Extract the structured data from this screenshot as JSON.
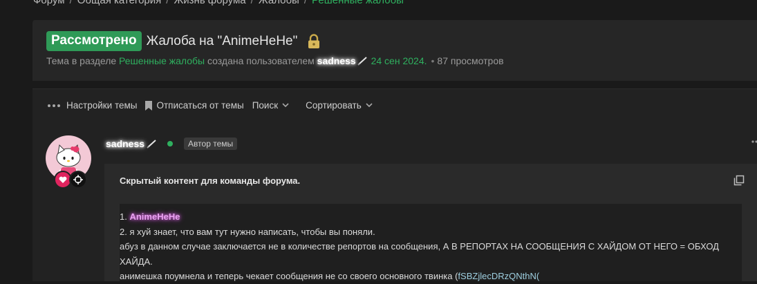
{
  "breadcrumb": {
    "items": [
      "Форум",
      "Общая категория",
      "Жизнь форума",
      "Жалобы"
    ],
    "current": "Решенные жалобы",
    "separator": "/"
  },
  "thread": {
    "status_badge": "Рассмотрено",
    "title": "Жалоба на \"AnimeHeHe\"",
    "locked_icon": "lock-icon",
    "meta_prefix": "Тема в разделе",
    "section": "Решенные жалобы",
    "created_by": "создана пользователем",
    "author": "sadness",
    "date": "24 сен 2024.",
    "views": "87 просмотров"
  },
  "toolbar": {
    "settings": "Настройки темы",
    "unsubscribe": "Отписаться от темы",
    "search": "Поиск",
    "sort": "Сортировать"
  },
  "post": {
    "username": "sadness",
    "author_tag": "Автор темы",
    "hidden_title": "Скрытый контент для команды форума.",
    "line1_prefix": "1. ",
    "line1_name": "AnimeHeHe",
    "line2": "2. я хуй знает, что вам тут нужно написать, чтобы вы поняли.",
    "line3": "абуз в данном случае заключается не в количестве репортов на сообщения, А В РЕПОРТАХ НА СООБЩЕНИЯ С ХАЙДОМ ОТ НЕГО = ОБХОД ХАЙДА.",
    "line4_prefix": "анимешка поумнела и теперь чекает сообщения не со своего основного твинка (",
    "line4_code": "fSBZjlecDRzQNthN("
  },
  "colors": {
    "accent_green": "#2fb05f",
    "badge_green": "#2f9a57",
    "background": "#1a1a1a"
  }
}
